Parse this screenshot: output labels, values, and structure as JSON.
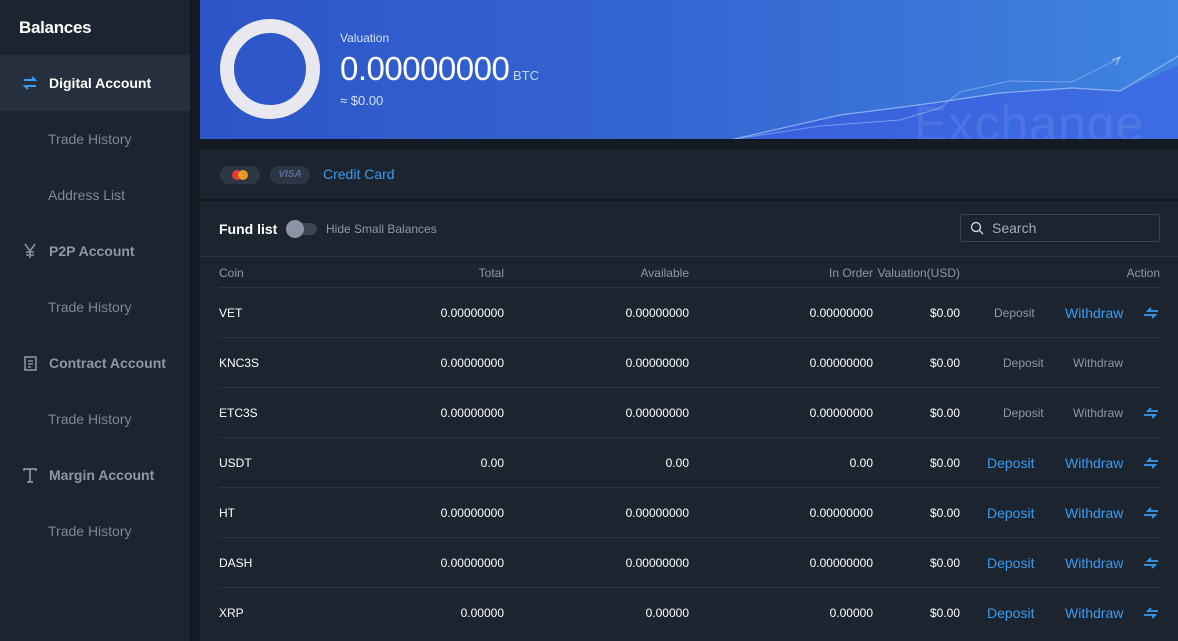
{
  "sidebar": {
    "title": "Balances",
    "items": [
      {
        "label": "Digital Account",
        "icon": "exchange-arrows-icon",
        "sub": "Trade History",
        "sub2": "Address List"
      },
      {
        "label": "P2P Account",
        "icon": "yen-icon",
        "sub": "Trade History"
      },
      {
        "label": "Contract Account",
        "icon": "document-icon",
        "sub": "Trade History"
      },
      {
        "label": "Margin Account",
        "icon": "text-cursor-icon",
        "sub": "Trade History"
      }
    ]
  },
  "banner": {
    "label": "Valuation",
    "value": "0.00000000",
    "unit": "BTC",
    "usd": "≈ $0.00",
    "watermark": "Exchange"
  },
  "cards": {
    "visa_text": "VISA",
    "link": "Credit Card"
  },
  "fund": {
    "title": "Fund list",
    "toggle_label": "Hide Small Balances",
    "search_placeholder": "Search",
    "columns": [
      "Coin",
      "Total",
      "Available",
      "In Order",
      "Valuation(USD)",
      "Action"
    ],
    "deposit_label": "Deposit",
    "withdraw_label": "Withdraw",
    "rows": [
      {
        "coin": "VET",
        "total": "0.00000000",
        "available": "0.00000000",
        "in_order": "0.00000000",
        "valuation": "$0.00",
        "deposit_active": false,
        "withdraw_active": true,
        "transfer": true
      },
      {
        "coin": "KNC3S",
        "total": "0.00000000",
        "available": "0.00000000",
        "in_order": "0.00000000",
        "valuation": "$0.00",
        "deposit_active": false,
        "withdraw_active": false,
        "transfer": false
      },
      {
        "coin": "ETC3S",
        "total": "0.00000000",
        "available": "0.00000000",
        "in_order": "0.00000000",
        "valuation": "$0.00",
        "deposit_active": false,
        "withdraw_active": false,
        "transfer": true
      },
      {
        "coin": "USDT",
        "total": "0.00",
        "available": "0.00",
        "in_order": "0.00",
        "valuation": "$0.00",
        "deposit_active": true,
        "withdraw_active": true,
        "transfer": true
      },
      {
        "coin": "HT",
        "total": "0.00000000",
        "available": "0.00000000",
        "in_order": "0.00000000",
        "valuation": "$0.00",
        "deposit_active": true,
        "withdraw_active": true,
        "transfer": true
      },
      {
        "coin": "DASH",
        "total": "0.00000000",
        "available": "0.00000000",
        "in_order": "0.00000000",
        "valuation": "$0.00",
        "deposit_active": true,
        "withdraw_active": true,
        "transfer": true
      },
      {
        "coin": "XRP",
        "total": "0.00000",
        "available": "0.00000",
        "in_order": "0.00000",
        "valuation": "$0.00",
        "deposit_active": true,
        "withdraw_active": true,
        "transfer": true
      }
    ]
  },
  "colors": {
    "accent": "#3a9bef",
    "sidebar_bg": "#1c2430",
    "page_bg": "#131a24",
    "banner_start": "#2c55c8",
    "banner_end": "#3f84e0"
  }
}
